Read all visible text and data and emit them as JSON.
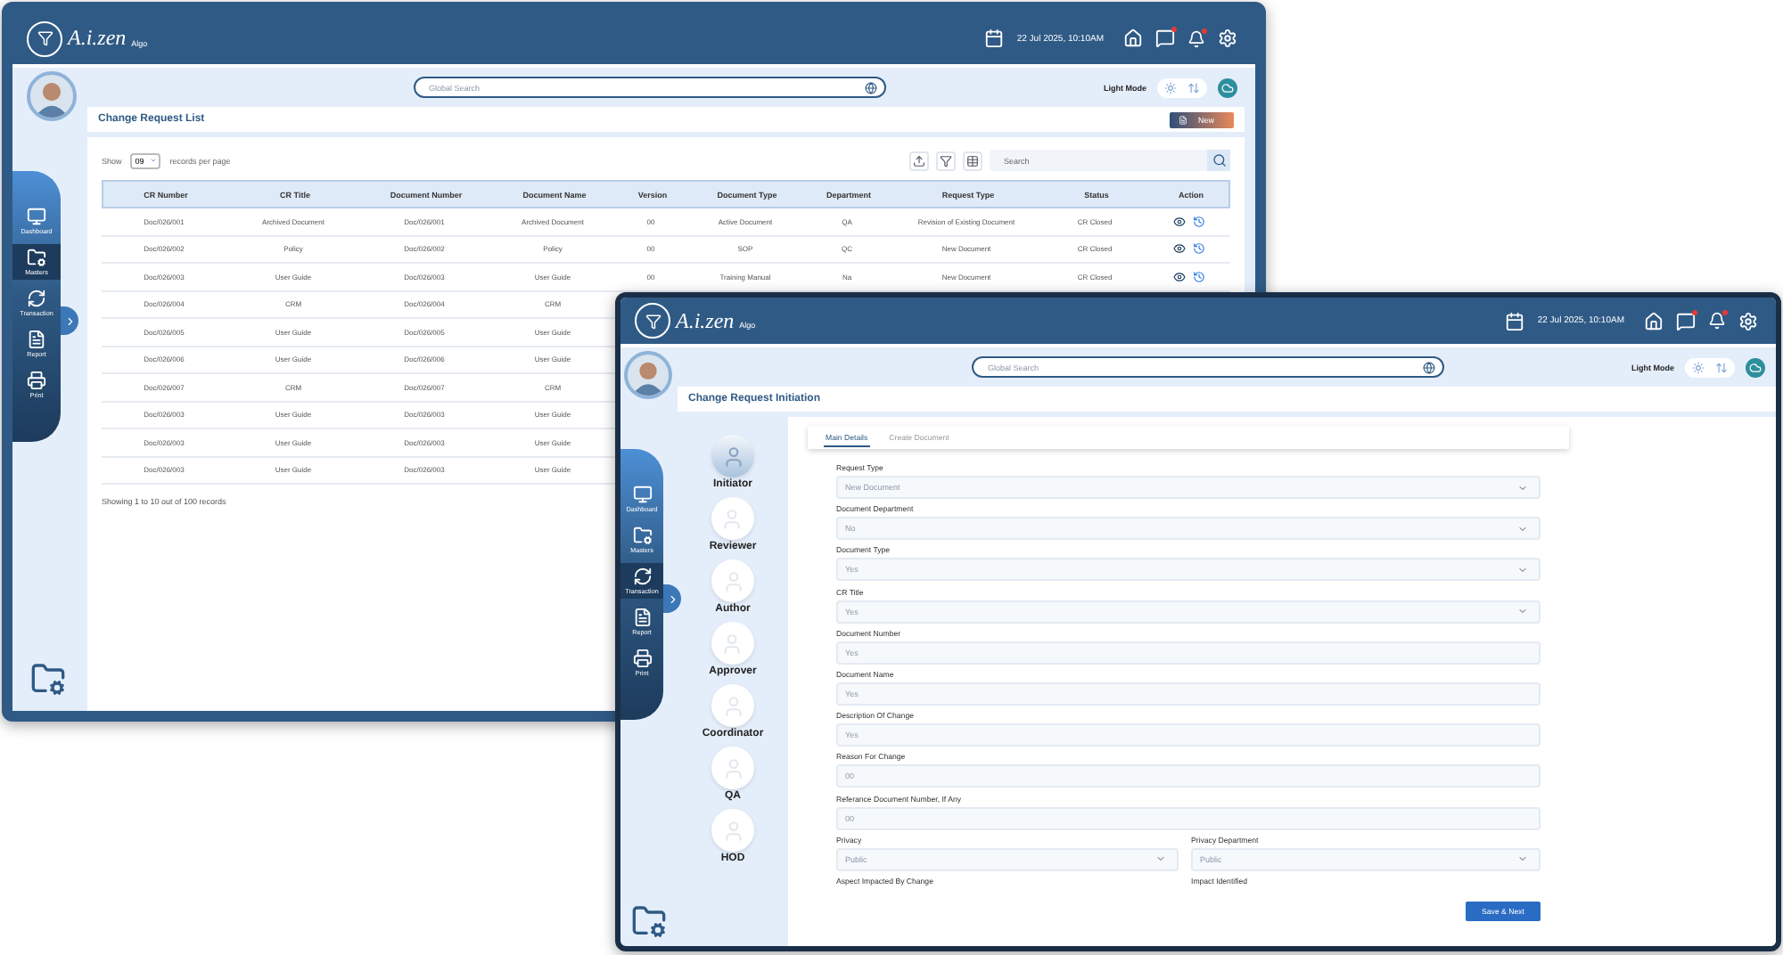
{
  "list_window": {
    "header": {
      "logo": "A.i.zen",
      "logo_sub": "Algo",
      "datetime": "22 Jul 2025, 10:10AM"
    },
    "search": {
      "placeholder": "Global Search"
    },
    "theme_label": "Light Mode",
    "nav": [
      {
        "label": "Dashboard",
        "selected": false
      },
      {
        "label": "Masters",
        "selected": true
      },
      {
        "label": "Transaction",
        "selected": false
      },
      {
        "label": "Report",
        "selected": false
      },
      {
        "label": "Print",
        "selected": false
      }
    ],
    "title": "Change Request List",
    "new_button": "New",
    "show_label": "Show",
    "per_page": "09",
    "per_page_suffix": "records per page",
    "table_search": {
      "placeholder": "Search"
    },
    "table": {
      "columns": [
        "CR Number",
        "CR Title",
        "Document Number",
        "Document Name",
        "Version",
        "Document Type",
        "Department",
        "Request Type",
        "Status",
        "Action"
      ],
      "rows": [
        {
          "cells": [
            "Doc/026/001",
            "Archived Document",
            "Doc/026/001",
            "Archived Document",
            "00",
            "Active Document",
            "QA",
            "Revision of Existing Document",
            "CR Closed"
          ]
        },
        {
          "cells": [
            "Doc/026/002",
            "Policy",
            "Doc/026/002",
            "Policy",
            "00",
            "SOP",
            "QC",
            "New Document",
            "CR Closed"
          ]
        },
        {
          "cells": [
            "Doc/026/003",
            "User Guide",
            "Doc/026/003",
            "User Guide",
            "00",
            "Training Manual",
            "Na",
            "New Document",
            "CR Closed"
          ]
        },
        {
          "cells": [
            "Doc/026/004",
            "CRM",
            "Doc/026/004",
            "CRM"
          ]
        },
        {
          "cells": [
            "Doc/026/005",
            "User Guide",
            "Doc/026/005",
            "User Guide"
          ]
        },
        {
          "cells": [
            "Doc/026/006",
            "User Guide",
            "Doc/026/006",
            "User Guide"
          ]
        },
        {
          "cells": [
            "Doc/026/007",
            "CRM",
            "Doc/026/007",
            "CRM"
          ]
        },
        {
          "cells": [
            "Doc/026/003",
            "User Guide",
            "Doc/026/003",
            "User Guide"
          ]
        },
        {
          "cells": [
            "Doc/026/003",
            "User Guide",
            "Doc/026/003",
            "User Guide"
          ]
        },
        {
          "cells": [
            "Doc/026/003",
            "User Guide",
            "Doc/026/003",
            "User Guide"
          ]
        }
      ]
    },
    "footer": "Showing 1 to 10 out of 100 records"
  },
  "initiation_window": {
    "header": {
      "logo": "A.i.zen",
      "logo_sub": "Algo",
      "datetime": "22 Jul 2025, 10:10AM"
    },
    "search": {
      "placeholder": "Global Search"
    },
    "theme_label": "Light Mode",
    "nav": [
      {
        "label": "Dashboard",
        "selected": false
      },
      {
        "label": "Masters",
        "selected": false
      },
      {
        "label": "Transaction",
        "selected": true
      },
      {
        "label": "Report",
        "selected": false
      },
      {
        "label": "Print",
        "selected": false
      }
    ],
    "title": "Change Request Initiation",
    "workflow": [
      {
        "label": "Initiator",
        "selected": true
      },
      {
        "label": "Reviewer",
        "selected": false
      },
      {
        "label": "Author",
        "selected": false
      },
      {
        "label": "Approver",
        "selected": false
      },
      {
        "label": "Coordinator",
        "selected": false
      },
      {
        "label": "QA",
        "selected": false
      },
      {
        "label": "HOD",
        "selected": false
      }
    ],
    "tabs": [
      {
        "label": "Main Details",
        "selected": true
      },
      {
        "label": "Create Document",
        "selected": false
      }
    ],
    "form_rows": [
      [
        {
          "label": "Request Type",
          "kind": "select",
          "placeholder": "New Document"
        }
      ],
      [
        {
          "label": "Document Department",
          "kind": "select",
          "placeholder": "No"
        }
      ],
      [
        {
          "label": "Document Type",
          "kind": "select",
          "placeholder": "Yes"
        }
      ],
      [
        {
          "label": "CR Title",
          "kind": "select",
          "placeholder": "Yes"
        }
      ],
      [
        {
          "label": "Document Number",
          "kind": "input",
          "placeholder": "Yes"
        }
      ],
      [
        {
          "label": "Document Name",
          "kind": "input",
          "placeholder": "Yes"
        }
      ],
      [
        {
          "label": "Description Of Change",
          "kind": "input",
          "placeholder": "Yes"
        }
      ],
      [
        {
          "label": "Reason For Change",
          "kind": "input",
          "placeholder": "00"
        }
      ],
      [
        {
          "label": "Referance Document Number, If Any",
          "kind": "input",
          "placeholder": "00"
        }
      ],
      [
        {
          "label": "Privacy",
          "kind": "select",
          "placeholder": "Public"
        },
        {
          "label": "Privacy Department",
          "kind": "select",
          "placeholder": "Public"
        }
      ],
      [
        {
          "label": "Aspect Impacted By Change",
          "kind": "label"
        },
        {
          "label": "Impact Identified",
          "kind": "label"
        }
      ]
    ],
    "save_button": "Save & Next"
  }
}
